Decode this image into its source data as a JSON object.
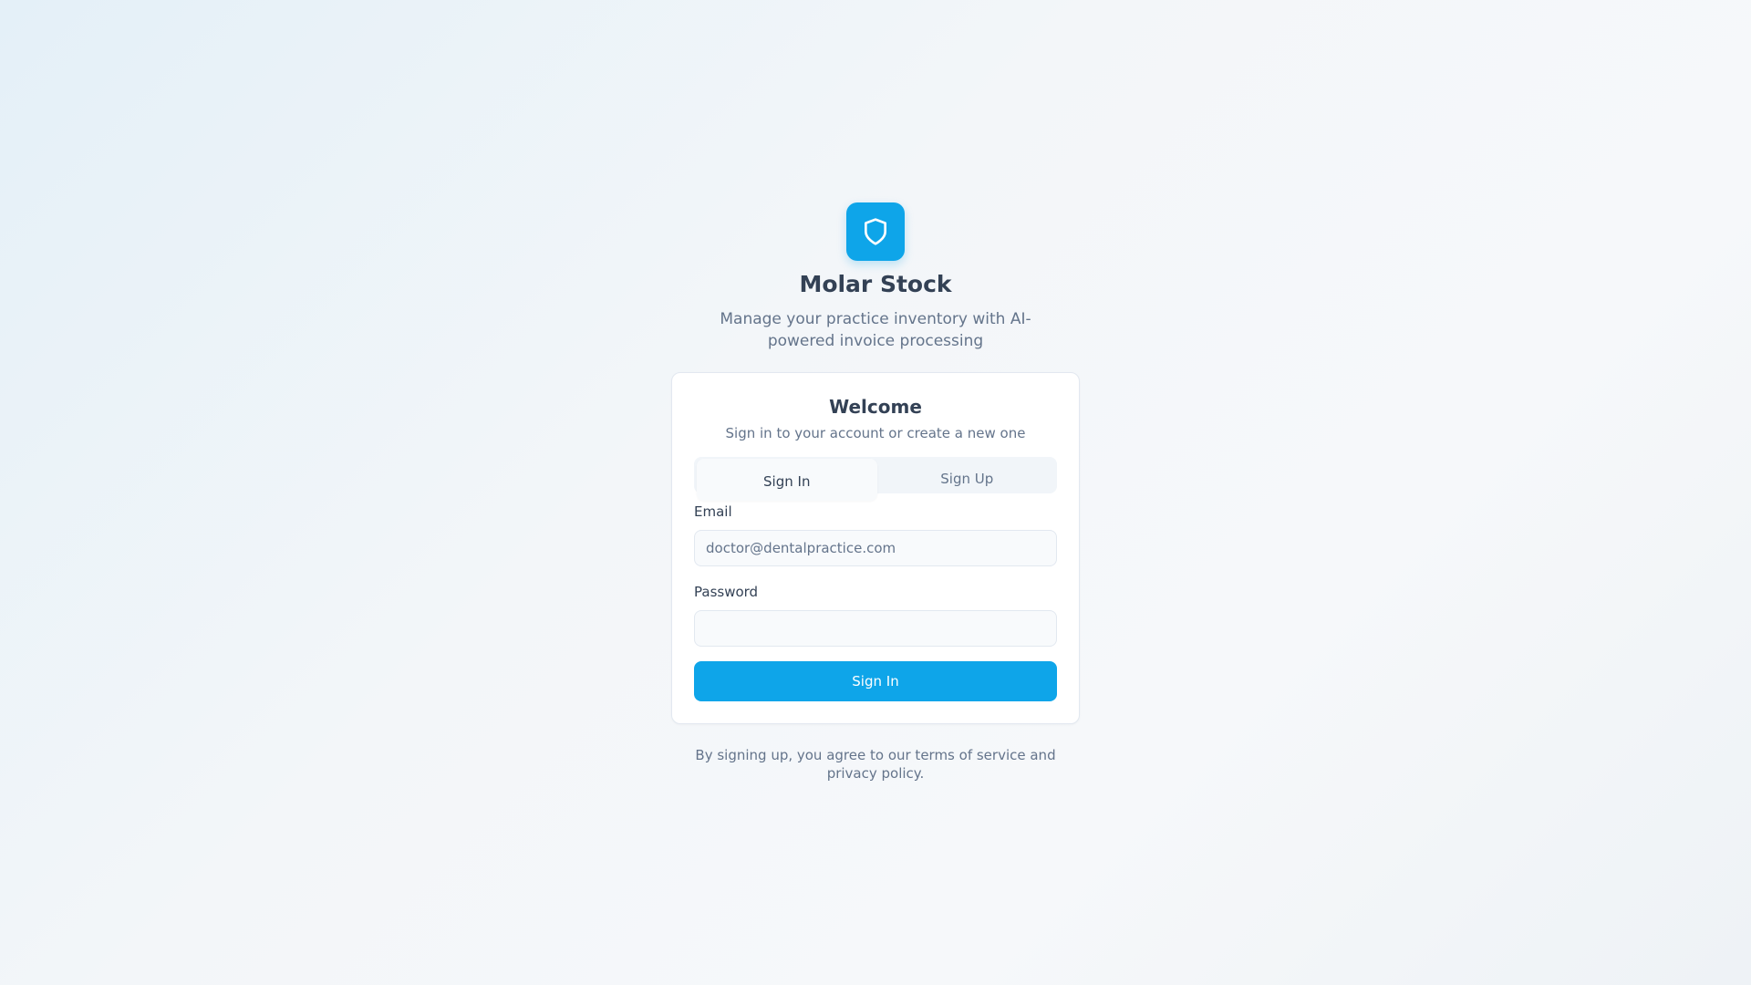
{
  "brand": {
    "icon": "shield-icon",
    "name": "Molar Stock",
    "tagline": "Manage your practice inventory with AI-powered invoice processing",
    "accent_color": "#0ea5e9"
  },
  "card": {
    "title": "Welcome",
    "subtitle": "Sign in to your account or create a new one",
    "tabs": [
      {
        "label": "Sign In",
        "active": true
      },
      {
        "label": "Sign Up",
        "active": false
      }
    ],
    "form": {
      "email": {
        "label": "Email",
        "placeholder": "doctor@dentalpractice.com",
        "value": ""
      },
      "password": {
        "label": "Password",
        "placeholder": "",
        "value": ""
      },
      "submit_label": "Sign In"
    }
  },
  "footer": {
    "terms_text": "By signing up, you agree to our terms of service and privacy policy."
  }
}
